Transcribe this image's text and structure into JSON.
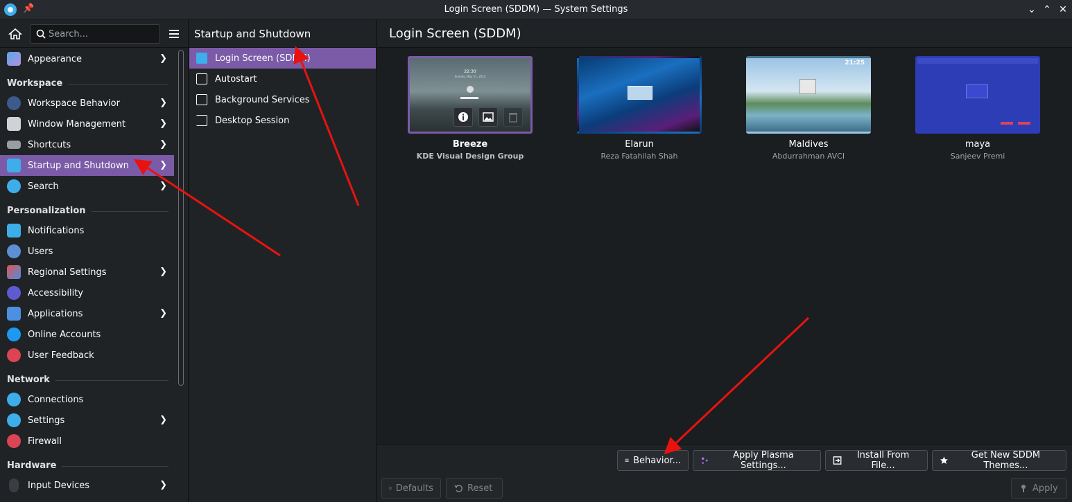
{
  "window": {
    "title": "Login Screen (SDDM) — System Settings",
    "controls": {
      "minimize": "⌄",
      "maximize": "⌃",
      "close": "✕"
    }
  },
  "sidebar": {
    "search_placeholder": "Search...",
    "items_top": [
      {
        "label": "Appearance",
        "has_submenu": true
      }
    ],
    "sections": [
      {
        "title": "Workspace",
        "items": [
          {
            "label": "Workspace Behavior",
            "has_submenu": true
          },
          {
            "label": "Window Management",
            "has_submenu": true
          },
          {
            "label": "Shortcuts",
            "has_submenu": true
          },
          {
            "label": "Startup and Shutdown",
            "has_submenu": true,
            "active": true
          },
          {
            "label": "Search",
            "has_submenu": true
          }
        ]
      },
      {
        "title": "Personalization",
        "items": [
          {
            "label": "Notifications",
            "has_submenu": false
          },
          {
            "label": "Users",
            "has_submenu": false
          },
          {
            "label": "Regional Settings",
            "has_submenu": true
          },
          {
            "label": "Accessibility",
            "has_submenu": false
          },
          {
            "label": "Applications",
            "has_submenu": true
          },
          {
            "label": "Online Accounts",
            "has_submenu": false
          },
          {
            "label": "User Feedback",
            "has_submenu": false
          }
        ]
      },
      {
        "title": "Network",
        "items": [
          {
            "label": "Connections",
            "has_submenu": false
          },
          {
            "label": "Settings",
            "has_submenu": true
          },
          {
            "label": "Firewall",
            "has_submenu": false
          }
        ]
      },
      {
        "title": "Hardware",
        "items": [
          {
            "label": "Input Devices",
            "has_submenu": true
          }
        ]
      }
    ]
  },
  "subpanel": {
    "title": "Startup and Shutdown",
    "items": [
      {
        "label": "Login Screen (SDDM)",
        "active": true
      },
      {
        "label": "Autostart"
      },
      {
        "label": "Background Services"
      },
      {
        "label": "Desktop Session"
      }
    ]
  },
  "main": {
    "title": "Login Screen (SDDM)",
    "themes": [
      {
        "name": "Breeze",
        "author": "KDE Visual Design Group",
        "selected": true,
        "preview_time": "22:30",
        "preview_date": "Sunday, May 21, 2023"
      },
      {
        "name": "Elarun",
        "author": "Reza Fatahilah Shah",
        "selected": false
      },
      {
        "name": "Maldives",
        "author": "Abdurrahman AVCI",
        "selected": false,
        "preview_time": "21:25"
      },
      {
        "name": "maya",
        "author": "Sanjeev Premi",
        "selected": false
      }
    ],
    "buttons": {
      "behavior": "Behavior...",
      "apply_plasma": "Apply Plasma Settings...",
      "install": "Install From File...",
      "get_new": "Get New SDDM Themes...",
      "defaults": "Defaults",
      "reset": "Reset",
      "apply": "Apply"
    }
  },
  "colors": {
    "accent": "#7b5ba8",
    "window_bg": "#1b1e20",
    "sidebar_bg": "#202326",
    "annotation_arrow": "#e8130f"
  }
}
